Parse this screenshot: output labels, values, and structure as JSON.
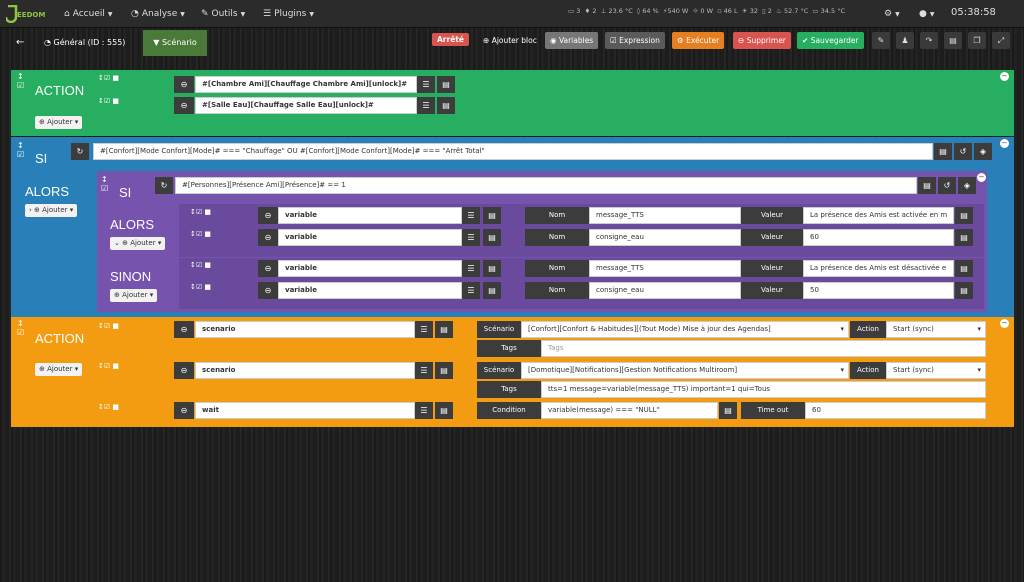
{
  "topbar": {
    "logo": "EEDOM",
    "nav": [
      "Accueil",
      "Analyse",
      "Outils",
      "Plugins"
    ],
    "stats": [
      "3",
      "2",
      "23.6 °C",
      "64 %",
      "540 W",
      "0 W",
      "46 L",
      "32",
      "2",
      "52.7 °C",
      "34.5 °C"
    ],
    "clock": "05:38:58"
  },
  "toolbar": {
    "scenario_name": "Général (ID : 555)",
    "scenario_tab": "Scénario",
    "status": "Arrêté",
    "add_block": "Ajouter bloc",
    "variables": "Variables",
    "expression": "Expression",
    "execute": "Exécuter",
    "delete": "Supprimer",
    "save": "Sauvegarder"
  },
  "labels": {
    "action": "ACTION",
    "si": "SI",
    "alors": "ALORS",
    "sinon": "SINON",
    "ajouter": "Ajouter",
    "nom": "Nom",
    "valeur": "Valeur",
    "scenario": "Scénario",
    "action_lbl": "Action",
    "tags": "Tags",
    "condition": "Condition",
    "timeout": "Time out"
  },
  "block1": {
    "cmd1": "#[Chambre Ami][Chauffage Chambre Ami][unlock]#",
    "cmd2": "#[Salle Eau][Chauffage Salle Eau][unlock]#"
  },
  "block2": {
    "condition": "#[Confort][Mode Confort][Mode]# === \"Chauffage\" OU #[Confort][Mode Confort][Mode]# === \"Arrêt Total\"",
    "inner_condition": "#[Personnes][Présence Ami][Présence]# == 1",
    "rows": [
      {
        "type": "variable",
        "nom": "message_TTS",
        "valeur": "La présence des Amis est activée en m"
      },
      {
        "type": "variable",
        "nom": "consigne_eau",
        "valeur": "60"
      },
      {
        "type": "variable",
        "nom": "message_TTS",
        "valeur": "La présence des Amis est désactivée e"
      },
      {
        "type": "variable",
        "nom": "consigne_eau",
        "valeur": "50"
      }
    ]
  },
  "block3": {
    "r1": {
      "type": "scenario",
      "scenario": "[Confort][Confort & Habitudes][(Tout Mode) Mise à jour des Agendas]",
      "action": "Start (sync)",
      "tags_placeholder": "Tags"
    },
    "r2": {
      "type": "scenario",
      "scenario": "[Domotique][Notifications][Gestion Notifications Multiroom]",
      "action": "Start (sync)",
      "tags": "tts=1 message=variable(message_TTS) important=1 qui=Tous"
    },
    "r3": {
      "type": "wait",
      "condition": "variable(message) === \"NULL\"",
      "timeout": "60"
    }
  },
  "colors": {
    "green": "#27ae60",
    "blue": "#2980b9",
    "purple": "#7653ad",
    "orange": "#f39c12"
  }
}
